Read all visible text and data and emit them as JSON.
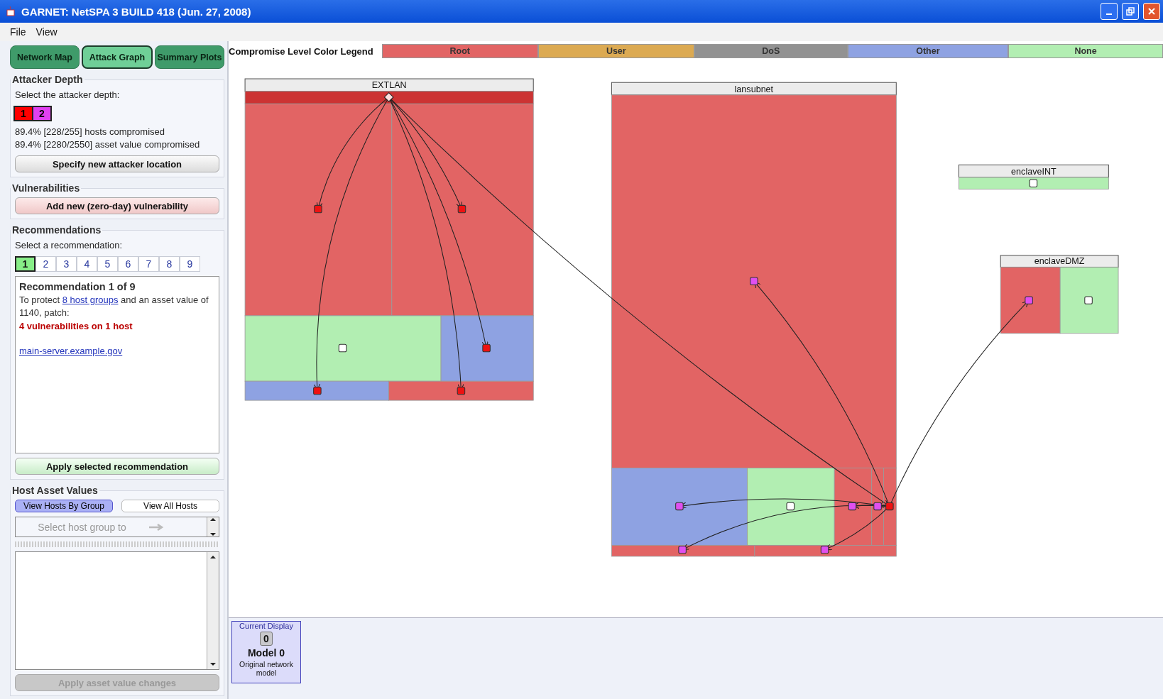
{
  "window": {
    "title": "GARNET: NetSPA 3 BUILD 418 (Jun. 27, 2008)"
  },
  "menu": [
    "File",
    "View"
  ],
  "tabs": [
    {
      "label": "Network Map",
      "selected": false
    },
    {
      "label": "Attack Graph",
      "selected": true
    },
    {
      "label": "Summary Plots",
      "selected": false
    }
  ],
  "attacker_depth": {
    "title": "Attacker Depth",
    "prompt": "Select the attacker depth:",
    "depths": [
      {
        "label": "1",
        "color": "#ff0000"
      },
      {
        "label": "2",
        "color": "#e040f0"
      }
    ],
    "stats": [
      "89.4% [228/255] hosts compromised",
      "89.4% [2280/2550] asset value compromised"
    ],
    "button": "Specify new attacker location"
  },
  "vulnerabilities": {
    "title": "Vulnerabilities",
    "button": "Add new (zero-day) vulnerability"
  },
  "recommendations": {
    "title": "Recommendations",
    "prompt": "Select a recommendation:",
    "options": [
      {
        "label": "1",
        "selected": true
      },
      {
        "label": "2",
        "selected": false
      },
      {
        "label": "3",
        "selected": false
      },
      {
        "label": "4",
        "selected": false
      },
      {
        "label": "5",
        "selected": false
      },
      {
        "label": "6",
        "selected": false
      },
      {
        "label": "7",
        "selected": false
      },
      {
        "label": "8",
        "selected": false
      },
      {
        "label": "9",
        "selected": false
      }
    ],
    "detail": {
      "heading": "Recommendation 1 of 9",
      "text_before": "To protect ",
      "link": "8 host groups",
      "text_after": " and an asset value of 1140, patch:",
      "warning": "4 vulnerabilities on 1 host",
      "host": "main-server.example.gov"
    },
    "button": "Apply selected recommendation"
  },
  "host_asset_values": {
    "title": "Host Asset Values",
    "views": [
      {
        "label": "View Hosts By Group",
        "selected": true
      },
      {
        "label": "View All Hosts",
        "selected": false
      }
    ],
    "selector": {
      "placeholder": "Select host group to"
    },
    "button": {
      "label": "Apply asset value changes",
      "disabled": true
    }
  },
  "legend": {
    "title": "Compromise Level Color Legend",
    "items": [
      {
        "label": "Root",
        "color": "#e26464"
      },
      {
        "label": "User",
        "color": "#dcaa52"
      },
      {
        "label": "DoS",
        "color": "#929292"
      },
      {
        "label": "Other",
        "color": "#8ea2e2"
      },
      {
        "label": "None",
        "color": "#b2eeb2"
      }
    ]
  },
  "groups": [
    {
      "title": "EXTLAN",
      "cells": [
        {
          "color": "#cc3333"
        },
        {
          "color": "#e26464"
        },
        {
          "color": "#e26464"
        },
        {
          "color": "#b2eeb2"
        },
        {
          "color": "#8ea2e2"
        },
        {
          "color": "#8ea2e2"
        },
        {
          "color": "#e26464"
        }
      ]
    },
    {
      "title": "lansubnet",
      "cells": [
        {
          "color": "#e26464"
        },
        {
          "color": "#8ea2e2"
        },
        {
          "color": "#b2eeb2"
        },
        {
          "color": "#e26464"
        },
        {
          "color": "#e26464"
        },
        {
          "color": "#e26464"
        },
        {
          "color": "#e26464"
        },
        {
          "color": "#e26464"
        }
      ]
    },
    {
      "title": "enclaveINT",
      "cells": [
        {
          "color": "#b2eeb2"
        }
      ]
    },
    {
      "title": "enclaveDMZ",
      "cells": [
        {
          "color": "#e26464"
        },
        {
          "color": "#b2eeb2"
        }
      ]
    }
  ],
  "current_display": {
    "title": "Current Display",
    "number": "0",
    "model": "Model 0",
    "description": "Original network model"
  }
}
